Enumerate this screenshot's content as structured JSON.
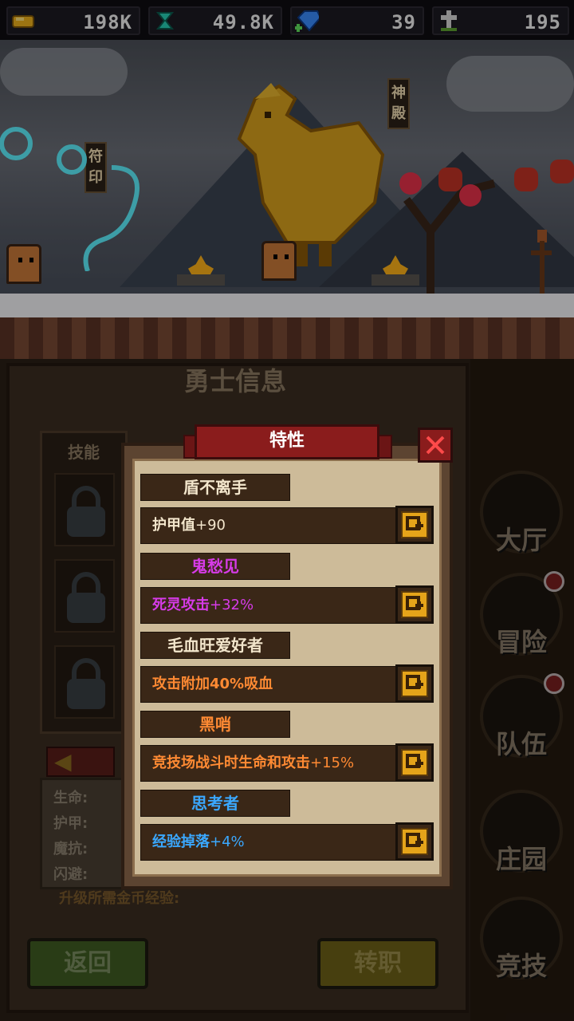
{
  "resources": [
    {
      "icon": "gold-coin-icon",
      "value": "198K"
    },
    {
      "icon": "green-crystal-icon",
      "value": "49.8K"
    },
    {
      "icon": "blue-gem-icon",
      "value": "39"
    },
    {
      "icon": "grave-cross-icon",
      "value": "195"
    }
  ],
  "scene": {
    "sign_left": [
      "符",
      "印"
    ],
    "sign_right": [
      "神",
      "殿"
    ]
  },
  "panel": {
    "title": "勇士信息",
    "skills_label": "技能",
    "stats": [
      "生命:",
      "护甲:",
      "魔抗:",
      "闪避:"
    ],
    "upgrade_text": "升级所需金币经验:",
    "back_button": "返回",
    "job_button": "转职"
  },
  "nav": [
    {
      "label": "大厅",
      "badge": false
    },
    {
      "label": "冒险",
      "badge": true
    },
    {
      "label": "队伍",
      "badge": true
    },
    {
      "label": "庄园",
      "badge": false
    },
    {
      "label": "竞技",
      "badge": false
    }
  ],
  "dialog": {
    "title": "特性",
    "traits": [
      {
        "name": "盾不离手",
        "name_color": "#f3e6cc",
        "desc": "护甲值",
        "bonus": "+90",
        "desc_color": "#f3e6cc"
      },
      {
        "name": "鬼愁见",
        "name_color": "#d63be8",
        "desc": "死灵攻击",
        "bonus": "+32%",
        "desc_color": "#d63be8"
      },
      {
        "name": "毛血旺爱好者",
        "name_color": "#f3e6cc",
        "desc": "攻击附加40%吸血",
        "bonus": "",
        "desc_color": "#ff8a33"
      },
      {
        "name": "黑哨",
        "name_color": "#ff8a33",
        "desc": "竞技场战斗时生命和攻击",
        "bonus": "+15%",
        "desc_color": "#ff8a33"
      },
      {
        "name": "思考者",
        "name_color": "#3aa8ff",
        "desc": "经验掉落",
        "bonus": "+4%",
        "desc_color": "#3aa8ff"
      }
    ]
  },
  "colors": {
    "ribbon": "#8a1c1c",
    "plus_button": "#e5a41a",
    "parchment": "#cdbb99"
  }
}
